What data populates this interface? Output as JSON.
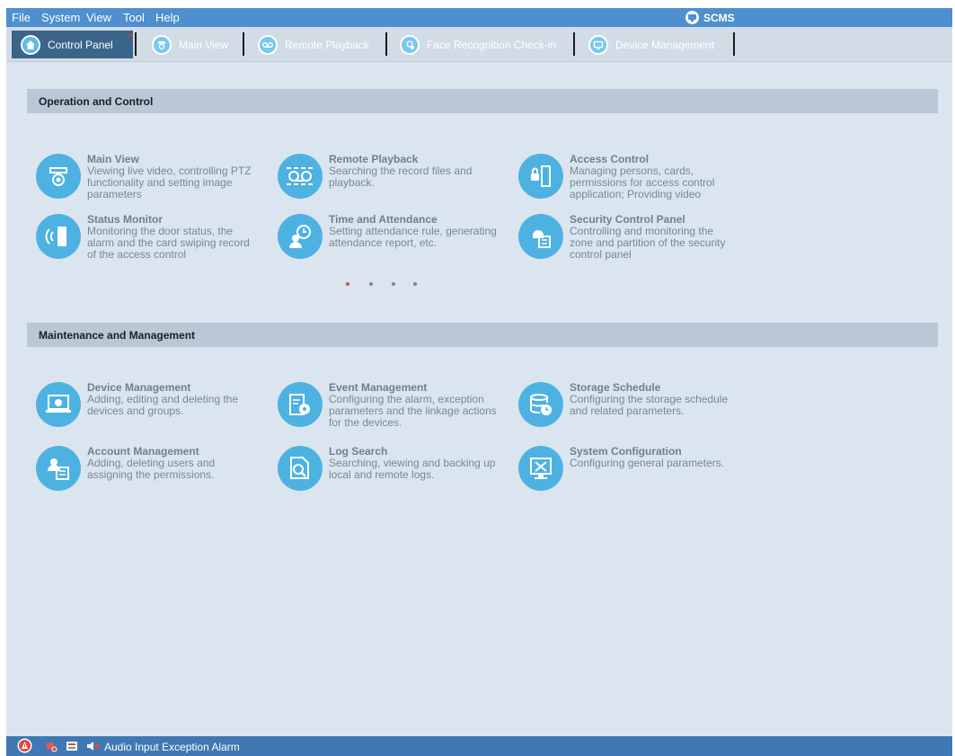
{
  "menu": {
    "file": "File",
    "system": "System",
    "view": "View",
    "tool": "Tool",
    "help": "Help"
  },
  "brand": "SCMS",
  "tabs": [
    {
      "label": "Control Panel",
      "active": true
    },
    {
      "label": "Main View"
    },
    {
      "label": "Remote Playback"
    },
    {
      "label": "Face Recognition Check-in"
    },
    {
      "label": "Device Management"
    }
  ],
  "sections": {
    "operation": {
      "title": "Operation and Control",
      "modules": [
        {
          "title": "Main View",
          "desc": "Viewing live video, controlling PTZ functionality and setting image parameters",
          "icon": "camera-icon"
        },
        {
          "title": "Remote Playback",
          "desc": "Searching the record files and playback.",
          "icon": "tape-icon"
        },
        {
          "title": "Access Control",
          "desc": "Managing persons, cards, permissions for access control application; Providing video",
          "icon": "door-lock-icon"
        },
        {
          "title": "Status Monitor",
          "desc": "Monitoring the door status, the alarm and the card swiping record of the access control",
          "icon": "door-signal-icon"
        },
        {
          "title": "Time and Attendance",
          "desc": "Setting attendance rule, generating attendance report, etc.",
          "icon": "person-clock-icon"
        },
        {
          "title": "Security Control Panel",
          "desc": "Controlling and monitoring the zone and partition of the security control panel",
          "icon": "bell-list-icon"
        }
      ]
    },
    "maintenance": {
      "title": "Maintenance and Management",
      "modules": [
        {
          "title": "Device Management",
          "desc": "Adding, editing and deleting the devices and groups.",
          "icon": "laptop-gear-icon"
        },
        {
          "title": "Event Management",
          "desc": "Configuring the alarm, exception parameters and the linkage actions for the devices.",
          "icon": "document-gear-icon"
        },
        {
          "title": "Storage Schedule",
          "desc": "Configuring the storage schedule and related parameters.",
          "icon": "database-clock-icon"
        },
        {
          "title": "Account Management",
          "desc": "Adding, deleting users and assigning the permissions.",
          "icon": "user-list-icon"
        },
        {
          "title": "Log Search",
          "desc": "Searching, viewing and backing up local and remote logs.",
          "icon": "document-search-icon"
        },
        {
          "title": "System Configuration",
          "desc": "Configuring general parameters.",
          "icon": "tools-monitor-icon"
        }
      ]
    }
  },
  "carousel": {
    "count": 4,
    "active_index": 0
  },
  "status": {
    "text": "Audio Input Exception Alarm"
  },
  "colors": {
    "accent": "#4db2e2",
    "menubar": "#4d8fcf",
    "statusbar": "#3f78b3",
    "active_tab": "#3a6588",
    "alarm": "#e04747"
  }
}
